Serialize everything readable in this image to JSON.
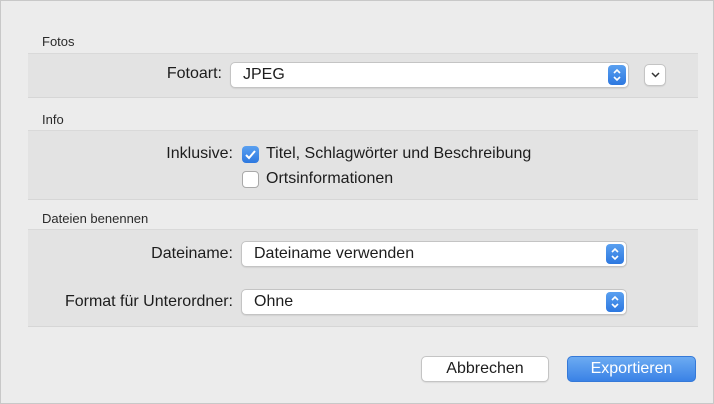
{
  "sections": {
    "fotos": {
      "title": "Fotos",
      "fotoart_label": "Fotoart:",
      "fotoart_value": "JPEG"
    },
    "info": {
      "title": "Info",
      "inklusive_label": "Inklusive:",
      "checkboxes": [
        {
          "label": "Titel, Schlagwörter und Beschreibung",
          "checked": true
        },
        {
          "label": "Ortsinformationen",
          "checked": false
        }
      ]
    },
    "dateien": {
      "title": "Dateien benennen",
      "dateiname_label": "Dateiname:",
      "dateiname_value": "Dateiname verwenden",
      "unterordner_label": "Format für Unterordner:",
      "unterordner_value": "Ohne"
    }
  },
  "buttons": {
    "cancel": "Abbrechen",
    "export": "Exportieren"
  },
  "colors": {
    "accent": "#3a82e6",
    "group_bg": "#e3e3e3",
    "window_bg": "#ececec"
  }
}
